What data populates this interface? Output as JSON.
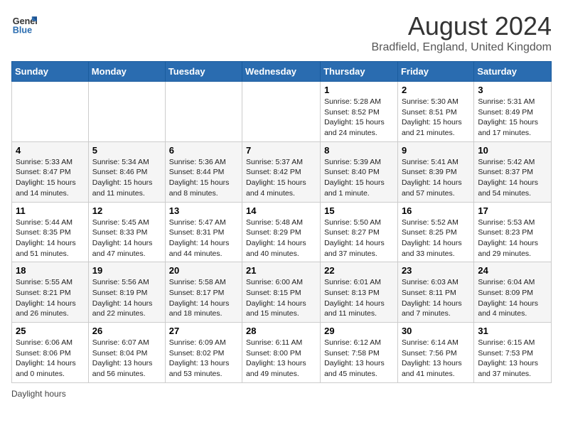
{
  "header": {
    "logo_line1": "General",
    "logo_line2": "Blue",
    "main_title": "August 2024",
    "subtitle": "Bradfield, England, United Kingdom"
  },
  "days_of_week": [
    "Sunday",
    "Monday",
    "Tuesday",
    "Wednesday",
    "Thursday",
    "Friday",
    "Saturday"
  ],
  "weeks": [
    [
      {
        "num": "",
        "info": ""
      },
      {
        "num": "",
        "info": ""
      },
      {
        "num": "",
        "info": ""
      },
      {
        "num": "",
        "info": ""
      },
      {
        "num": "1",
        "info": "Sunrise: 5:28 AM\nSunset: 8:52 PM\nDaylight: 15 hours\nand 24 minutes."
      },
      {
        "num": "2",
        "info": "Sunrise: 5:30 AM\nSunset: 8:51 PM\nDaylight: 15 hours\nand 21 minutes."
      },
      {
        "num": "3",
        "info": "Sunrise: 5:31 AM\nSunset: 8:49 PM\nDaylight: 15 hours\nand 17 minutes."
      }
    ],
    [
      {
        "num": "4",
        "info": "Sunrise: 5:33 AM\nSunset: 8:47 PM\nDaylight: 15 hours\nand 14 minutes."
      },
      {
        "num": "5",
        "info": "Sunrise: 5:34 AM\nSunset: 8:46 PM\nDaylight: 15 hours\nand 11 minutes."
      },
      {
        "num": "6",
        "info": "Sunrise: 5:36 AM\nSunset: 8:44 PM\nDaylight: 15 hours\nand 8 minutes."
      },
      {
        "num": "7",
        "info": "Sunrise: 5:37 AM\nSunset: 8:42 PM\nDaylight: 15 hours\nand 4 minutes."
      },
      {
        "num": "8",
        "info": "Sunrise: 5:39 AM\nSunset: 8:40 PM\nDaylight: 15 hours\nand 1 minute."
      },
      {
        "num": "9",
        "info": "Sunrise: 5:41 AM\nSunset: 8:39 PM\nDaylight: 14 hours\nand 57 minutes."
      },
      {
        "num": "10",
        "info": "Sunrise: 5:42 AM\nSunset: 8:37 PM\nDaylight: 14 hours\nand 54 minutes."
      }
    ],
    [
      {
        "num": "11",
        "info": "Sunrise: 5:44 AM\nSunset: 8:35 PM\nDaylight: 14 hours\nand 51 minutes."
      },
      {
        "num": "12",
        "info": "Sunrise: 5:45 AM\nSunset: 8:33 PM\nDaylight: 14 hours\nand 47 minutes."
      },
      {
        "num": "13",
        "info": "Sunrise: 5:47 AM\nSunset: 8:31 PM\nDaylight: 14 hours\nand 44 minutes."
      },
      {
        "num": "14",
        "info": "Sunrise: 5:48 AM\nSunset: 8:29 PM\nDaylight: 14 hours\nand 40 minutes."
      },
      {
        "num": "15",
        "info": "Sunrise: 5:50 AM\nSunset: 8:27 PM\nDaylight: 14 hours\nand 37 minutes."
      },
      {
        "num": "16",
        "info": "Sunrise: 5:52 AM\nSunset: 8:25 PM\nDaylight: 14 hours\nand 33 minutes."
      },
      {
        "num": "17",
        "info": "Sunrise: 5:53 AM\nSunset: 8:23 PM\nDaylight: 14 hours\nand 29 minutes."
      }
    ],
    [
      {
        "num": "18",
        "info": "Sunrise: 5:55 AM\nSunset: 8:21 PM\nDaylight: 14 hours\nand 26 minutes."
      },
      {
        "num": "19",
        "info": "Sunrise: 5:56 AM\nSunset: 8:19 PM\nDaylight: 14 hours\nand 22 minutes."
      },
      {
        "num": "20",
        "info": "Sunrise: 5:58 AM\nSunset: 8:17 PM\nDaylight: 14 hours\nand 18 minutes."
      },
      {
        "num": "21",
        "info": "Sunrise: 6:00 AM\nSunset: 8:15 PM\nDaylight: 14 hours\nand 15 minutes."
      },
      {
        "num": "22",
        "info": "Sunrise: 6:01 AM\nSunset: 8:13 PM\nDaylight: 14 hours\nand 11 minutes."
      },
      {
        "num": "23",
        "info": "Sunrise: 6:03 AM\nSunset: 8:11 PM\nDaylight: 14 hours\nand 7 minutes."
      },
      {
        "num": "24",
        "info": "Sunrise: 6:04 AM\nSunset: 8:09 PM\nDaylight: 14 hours\nand 4 minutes."
      }
    ],
    [
      {
        "num": "25",
        "info": "Sunrise: 6:06 AM\nSunset: 8:06 PM\nDaylight: 14 hours\nand 0 minutes."
      },
      {
        "num": "26",
        "info": "Sunrise: 6:07 AM\nSunset: 8:04 PM\nDaylight: 13 hours\nand 56 minutes."
      },
      {
        "num": "27",
        "info": "Sunrise: 6:09 AM\nSunset: 8:02 PM\nDaylight: 13 hours\nand 53 minutes."
      },
      {
        "num": "28",
        "info": "Sunrise: 6:11 AM\nSunset: 8:00 PM\nDaylight: 13 hours\nand 49 minutes."
      },
      {
        "num": "29",
        "info": "Sunrise: 6:12 AM\nSunset: 7:58 PM\nDaylight: 13 hours\nand 45 minutes."
      },
      {
        "num": "30",
        "info": "Sunrise: 6:14 AM\nSunset: 7:56 PM\nDaylight: 13 hours\nand 41 minutes."
      },
      {
        "num": "31",
        "info": "Sunrise: 6:15 AM\nSunset: 7:53 PM\nDaylight: 13 hours\nand 37 minutes."
      }
    ]
  ],
  "footer": {
    "note": "Daylight hours"
  },
  "colors": {
    "header_bg": "#2a6cb0",
    "header_text": "#ffffff"
  }
}
